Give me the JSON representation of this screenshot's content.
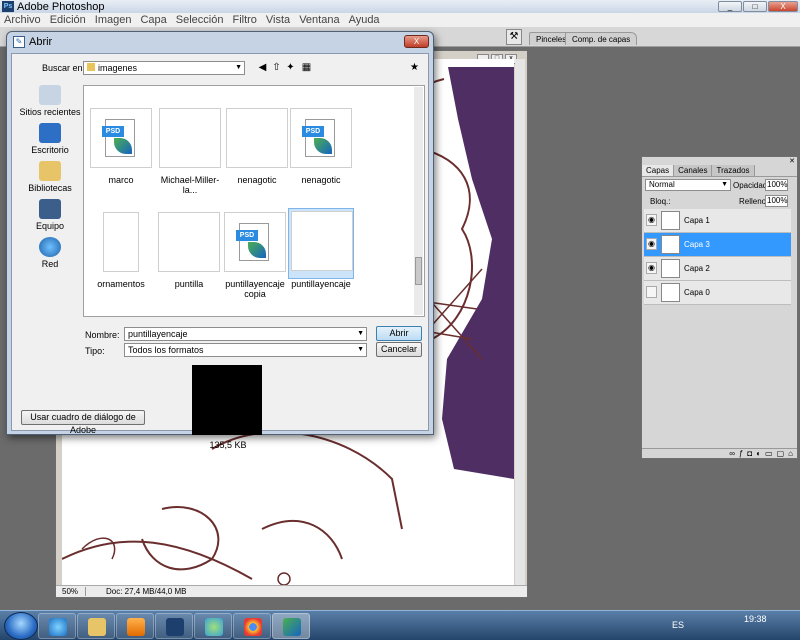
{
  "app": {
    "title": "Adobe Photoshop",
    "menu": [
      "Archivo",
      "Edición",
      "Imagen",
      "Capa",
      "Selección",
      "Filtro",
      "Vista",
      "Ventana",
      "Ayuda"
    ],
    "well_tabs": [
      "Pinceles",
      "Comp. de capas"
    ],
    "window_buttons": {
      "minimize": "_",
      "maximize": "□",
      "close": "X"
    }
  },
  "document": {
    "zoom": "50%",
    "doc_info": "Doc: 27,4 MB/44,0 MB"
  },
  "dialog": {
    "title": "Abrir",
    "close": "X",
    "look_in_label": "Buscar en:",
    "look_in_value": "imagenes",
    "places": [
      "Sitios recientes",
      "Escritorio",
      "Bibliotecas",
      "Equipo",
      "Red"
    ],
    "files": [
      {
        "name": "marco",
        "kind": "psd"
      },
      {
        "name": "Michael-Miller-la...",
        "kind": "damask"
      },
      {
        "name": "nenagotic",
        "kind": "light"
      },
      {
        "name": "nenagotic",
        "kind": "psd"
      },
      {
        "name": "ornamentos",
        "kind": "orn"
      },
      {
        "name": "puntilla",
        "kind": "black"
      },
      {
        "name": "puntillayencaje copia",
        "kind": "psd"
      },
      {
        "name": "puntillayencaje",
        "kind": "black",
        "selected": true
      }
    ],
    "name_label": "Nombre:",
    "name_value": "puntillayencaje",
    "type_label": "Tipo:",
    "type_value": "Todos los formatos",
    "open_button": "Abrir",
    "cancel_button": "Cancelar",
    "preview_size": "135,5 KB",
    "adobe_dialog_button": "Usar cuadro de diálogo de Adobe"
  },
  "layers_panel": {
    "tabs": [
      "Capas",
      "Canales",
      "Trazados"
    ],
    "blend_mode": "Normal",
    "opacity_label": "Opacidad:",
    "opacity_value": "100%",
    "lock_label": "Bloq.:",
    "fill_label": "Relleno:",
    "fill_value": "100%",
    "layers": [
      {
        "name": "Capa 1",
        "visible": true,
        "selected": false
      },
      {
        "name": "Capa 3",
        "visible": true,
        "selected": true
      },
      {
        "name": "Capa 2",
        "visible": true,
        "selected": false
      },
      {
        "name": "Capa 0",
        "visible": false,
        "selected": false
      }
    ]
  },
  "taskbar": {
    "language": "ES",
    "time": "19:38"
  }
}
